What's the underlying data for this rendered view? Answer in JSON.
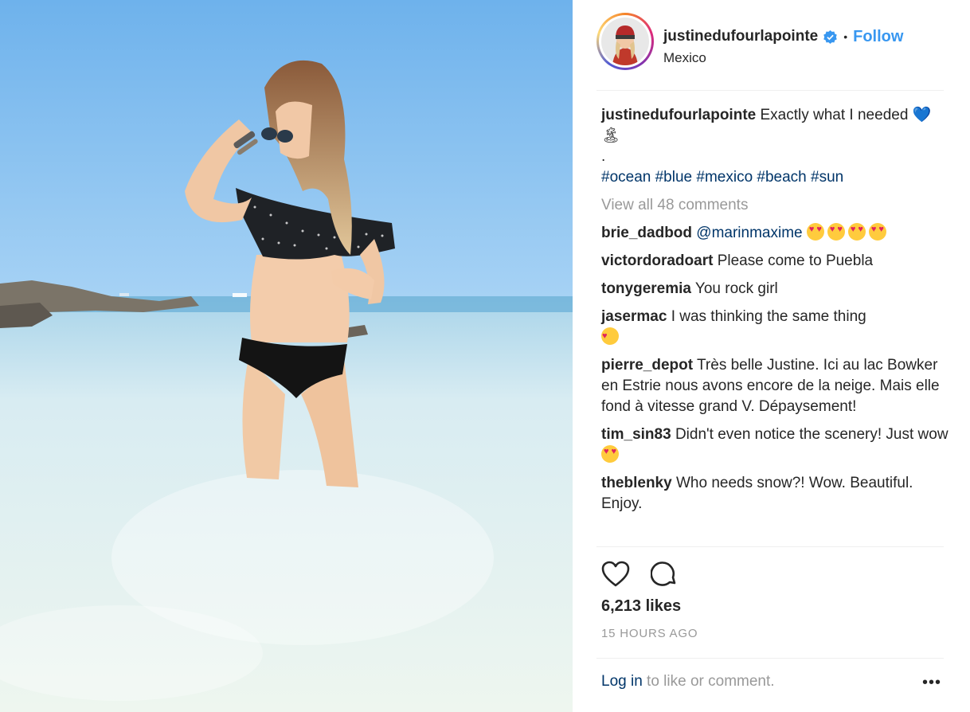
{
  "header": {
    "username": "justinedufourlapointe",
    "verified_icon": "verified-badge-icon",
    "dot": "•",
    "follow_label": "Follow",
    "location": "Mexico"
  },
  "caption": {
    "username": "justinedufourlapointe",
    "text": "Exactly what I needed",
    "emoji": "💙🏝",
    "separator": ".",
    "hashtags": "#ocean #blue #mexico #beach #sun"
  },
  "view_all_comments": "View all 48 comments",
  "comments": [
    {
      "user": "brie_dadbod",
      "text": "@marinmaxime"
    },
    {
      "user": "victordoradoart",
      "text": "Please come to Puebla"
    },
    {
      "user": "tonygeremia",
      "text": "You rock girl"
    },
    {
      "user": "jasermac",
      "text": "I was thinking the same thing"
    },
    {
      "user": "pierre_depot",
      "text": "Très belle Justine. Ici au lac Bowker en Estrie nous avons encore de la neige. Mais elle fond à vitesse grand V. Dépaysement!"
    },
    {
      "user": "tim_sin83",
      "text": "Didn't even notice the scenery! Just wow"
    },
    {
      "user": "theblenky",
      "text": "Who needs snow?! Wow. Beautiful. Enjoy."
    }
  ],
  "actions": {
    "like_icon": "heart-icon",
    "comment_icon": "comment-bubble-icon"
  },
  "likes": "6,213 likes",
  "time": "15 HOURS AGO",
  "footer": {
    "login_link": "Log in",
    "login_text": " to like or comment.",
    "more_label": "•••"
  },
  "colors": {
    "link_blue": "#3897f0",
    "hashtag": "#003569",
    "muted": "#999999"
  }
}
